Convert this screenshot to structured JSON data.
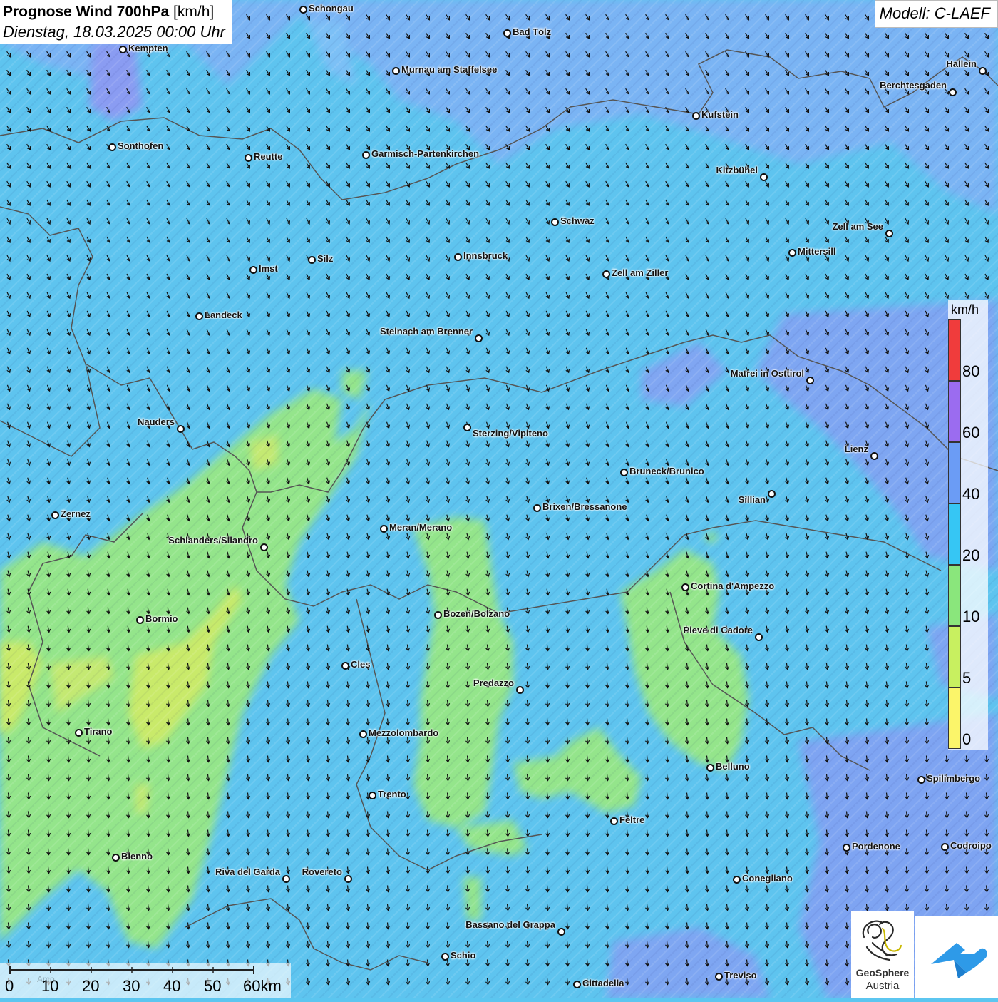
{
  "title": {
    "bold": "Prognose Wind 700hPa",
    "unit": "[km/h]",
    "date": "Dienstag, 18.03.2025 00:00 Uhr"
  },
  "model": "Modell: C-LAEF",
  "cities": [
    {
      "name": "Schongau"
    },
    {
      "name": "Bad Tölz"
    },
    {
      "name": "Kempten"
    },
    {
      "name": "Murnau am Staffelsee"
    },
    {
      "name": "Hallein"
    },
    {
      "name": "Berchtesgaden"
    },
    {
      "name": "Kufstein"
    },
    {
      "name": "Sonthofen"
    },
    {
      "name": "Reutte"
    },
    {
      "name": "Garmisch-Partenkirchen"
    },
    {
      "name": "Kitzbühel"
    },
    {
      "name": "Schwaz"
    },
    {
      "name": "Zell am See"
    },
    {
      "name": "Mittersill"
    },
    {
      "name": "Innsbruck"
    },
    {
      "name": "Silz"
    },
    {
      "name": "Imst"
    },
    {
      "name": "Zell am Ziller"
    },
    {
      "name": "Landeck"
    },
    {
      "name": "Steinach am Brenner"
    },
    {
      "name": "Matrei in Osttirol"
    },
    {
      "name": "Nauders"
    },
    {
      "name": "Sterzing/Vipiteno"
    },
    {
      "name": "Lienz"
    },
    {
      "name": "Bruneck/Brunico"
    },
    {
      "name": "Sillian"
    },
    {
      "name": "Brixen/Bressanone"
    },
    {
      "name": "Zernez"
    },
    {
      "name": "Meran/Merano"
    },
    {
      "name": "Schlanders/Silandro"
    },
    {
      "name": "Cortina d'Ampezzo"
    },
    {
      "name": "Bozen/Bolzano"
    },
    {
      "name": "Bormio"
    },
    {
      "name": "Pieve di Cadore"
    },
    {
      "name": "Cles"
    },
    {
      "name": "Predazzo"
    },
    {
      "name": "Tirano"
    },
    {
      "name": "Mezzolombardo"
    },
    {
      "name": "Belluno"
    },
    {
      "name": "Spilimbergo"
    },
    {
      "name": "Trento"
    },
    {
      "name": "Feltre"
    },
    {
      "name": "Pordenone"
    },
    {
      "name": "Codroipo"
    },
    {
      "name": "Bienno"
    },
    {
      "name": "Riva del Garda"
    },
    {
      "name": "Rovereto"
    },
    {
      "name": "Conegliano"
    },
    {
      "name": "Bassano del Grappa"
    },
    {
      "name": "Schio"
    },
    {
      "name": "Treviso"
    },
    {
      "name": "Cittadella"
    }
  ],
  "legend": {
    "unit": "km/h",
    "ticks": [
      "80",
      "60",
      "40",
      "20",
      "10",
      "5",
      "0"
    ],
    "colors": {
      "80-100": "#f03c3c",
      "60-80": "#9b6cf0",
      "40-60": "#6b9cf5",
      "20-40": "#36c6f4",
      "10-20": "#8ae67c",
      "5-10": "#c8f060",
      "0-5": "#fbf56a"
    }
  },
  "scale": {
    "labels": [
      "0",
      "10",
      "20",
      "30",
      "40",
      "50",
      "60km"
    ],
    "faint_label": "Arco"
  },
  "logo": {
    "line1": "GeoSphere",
    "line2": "Austria",
    "icon": "geosphere-logo-icon",
    "app_icon": "cloud-arrow-icon"
  },
  "map_colors": {
    "base_blue": "#5cc6f0",
    "upper_band": "#79b2f5",
    "purple_patch": "#8e98f0",
    "green_zone": "#92e68a",
    "yellow_zone": "#cfe86a",
    "wind_arrow": "#111111"
  }
}
